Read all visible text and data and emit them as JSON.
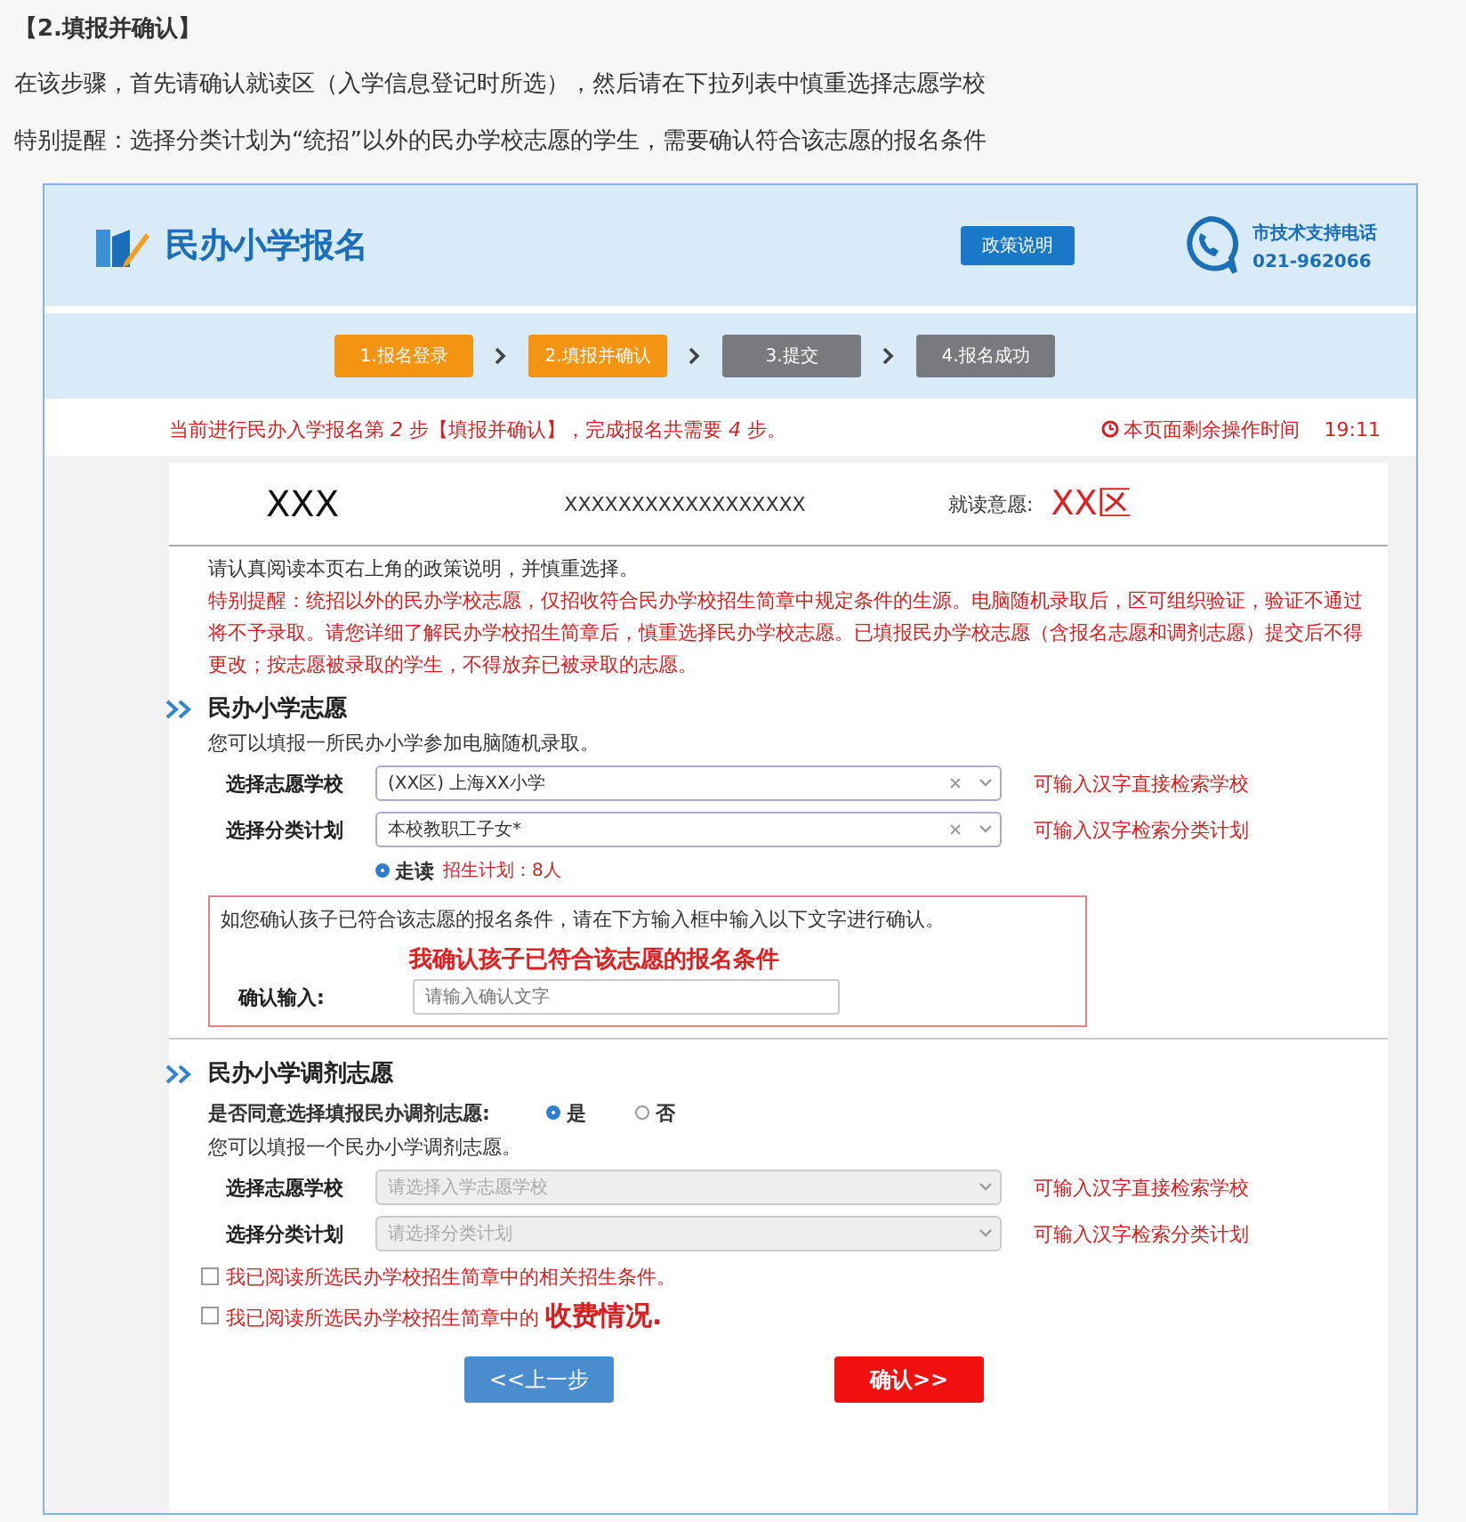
{
  "article": {
    "heading": "【2.填报并确认】",
    "paragraphs": [
      "在该步骤，首先请确认就读区（入学信息登记时所选），然后请在下拉列表中慎重选择志愿学校",
      "特别提醒：选择分类计划为“统招”以外的民办学校志愿的学生，需要确认符合该志愿的报名条件"
    ]
  },
  "portal": {
    "title": "民办小学报名",
    "policy_button": "政策说明",
    "support": {
      "label": "市技术支持电话",
      "phone": "021-962066"
    }
  },
  "steps": [
    {
      "label": "1.报名登录",
      "active": true
    },
    {
      "label": "2.填报并确认",
      "active": true
    },
    {
      "label": "3.提交",
      "active": false
    },
    {
      "label": "4.报名成功",
      "active": false
    }
  ],
  "notice": "当前进行民办入学报名第 *2* 步【填报并确认】，完成报名共需要 *4* 步。",
  "timer": {
    "label": "本页面剩余操作时间",
    "time": "19:11"
  },
  "applicant": {
    "name": "XXX",
    "id_number": "XXXXXXXXXXXXXXXXXX",
    "district_label": "就读意愿:",
    "district": "XX区"
  },
  "intro": {
    "text": "请认真阅读本页右上角的政策说明，并慎重选择。",
    "warning": "特别提醒：统招以外的民办学校志愿，仅招收符合民办学校招生简章中规定条件的生源。电脑随机录取后，区可组织验证，验证不通过将不予录取。请您详细了解民办学校招生简章后，慎重选择民办学校志愿。已填报民办学校志愿（含报名志愿和调剂志愿）提交后不得更改；按志愿被录取的学生，不得放弃已被录取的志愿。"
  },
  "section_choice": {
    "title": "民办小学志愿",
    "subtitle": "您可以填报一所民办小学参加电脑随机录取。",
    "fields": [
      {
        "label": "选择志愿学校",
        "value": "(XX区) 上海XX小学",
        "hint": "可输入汉字直接检索学校"
      },
      {
        "label": "选择分类计划",
        "value": "本校教职工子女*",
        "hint": "可输入汉字检索分类计划"
      }
    ],
    "options": [
      {
        "label": "走读",
        "quota": "招生计划：8人",
        "selected": true
      }
    ],
    "confirm_box": {
      "instruction": "如您确认孩子已符合该志愿的报名条件，请在下方输入框中输入以下文字进行确认。",
      "phrase": "我确认孩子已符合该志愿的报名条件",
      "input_label": "确认输入:",
      "placeholder": "请输入确认文字"
    }
  },
  "section_adjust": {
    "title": "民办小学调剂志愿",
    "question": "是否同意选择填报民办调剂志愿:",
    "answers": [
      {
        "label": "是",
        "selected": true
      },
      {
        "label": "否",
        "selected": false
      }
    ],
    "subtitle": "您可以填报一个民办小学调剂志愿。",
    "fields": [
      {
        "label": "选择志愿学校",
        "placeholder": "请选择入学志愿学校",
        "hint": "可输入汉字直接检索学校"
      },
      {
        "label": "选择分类计划",
        "placeholder": "请选择分类计划",
        "hint": "可输入汉字检索分类计划"
      }
    ],
    "checkboxes": [
      {
        "text": "我已阅读所选民办学校招生简章中的相关招生条件。",
        "checked": false
      },
      {
        "text": "我已阅读所选民办学校招生简章中的 **收费情况.**",
        "checked": false
      }
    ]
  },
  "buttons": [
    {
      "label": "<<上一步",
      "kind": "back"
    },
    {
      "label": "确认>>",
      "kind": "confirm"
    }
  ]
}
